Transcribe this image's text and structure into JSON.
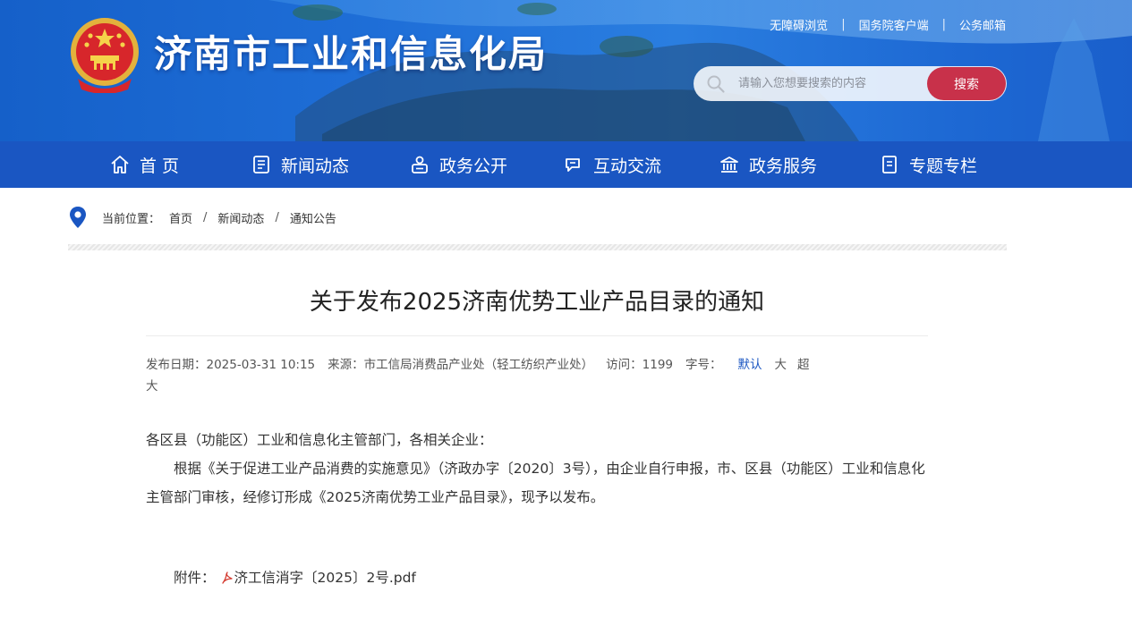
{
  "header": {
    "site_title": "济南市工业和信息化局",
    "top_links": [
      "无障碍浏览",
      "国务院客户端",
      "公务邮箱"
    ],
    "search_placeholder": "请输入您想要搜索的内容",
    "search_button": "搜索"
  },
  "nav": {
    "items": [
      {
        "label": "首 页",
        "icon": "home-icon"
      },
      {
        "label": "新闻动态",
        "icon": "news-icon"
      },
      {
        "label": "政务公开",
        "icon": "gov-open-icon"
      },
      {
        "label": "互动交流",
        "icon": "chat-icon"
      },
      {
        "label": "政务服务",
        "icon": "service-icon"
      },
      {
        "label": "专题专栏",
        "icon": "topic-icon"
      }
    ]
  },
  "breadcrumb": {
    "prefix": "当前位置：",
    "items": [
      "首页",
      "新闻动态",
      "通知公告"
    ],
    "separator": "/"
  },
  "article": {
    "title": "关于发布2025济南优势工业产品目录的通知",
    "meta": {
      "date": "发布日期：2025-03-31 10:15",
      "source": "来源：市工信局消费品产业处（轻工纺织产业处）",
      "visits": "访问：1199",
      "font_label": "字号：",
      "font_sizes": [
        "默认",
        "大",
        "超大"
      ]
    },
    "salutation": "各区县（功能区）工业和信息化主管部门，各相关企业：",
    "paragraph": "根据《关于促进工业产品消费的实施意见》（济政办字〔2020〕3号），由企业自行申报，市、区县（功能区）工业和信息化主管部门审核，经修订形成《2025济南优势工业产品目录》，现予以发布。",
    "attachment_label": "附件：",
    "attachment_file": "济工信消字〔2025〕2号.pdf"
  },
  "colors": {
    "nav_bg": "#1a56c2",
    "search_button": "#c8314a",
    "active_font_size": "#1a56c2"
  }
}
